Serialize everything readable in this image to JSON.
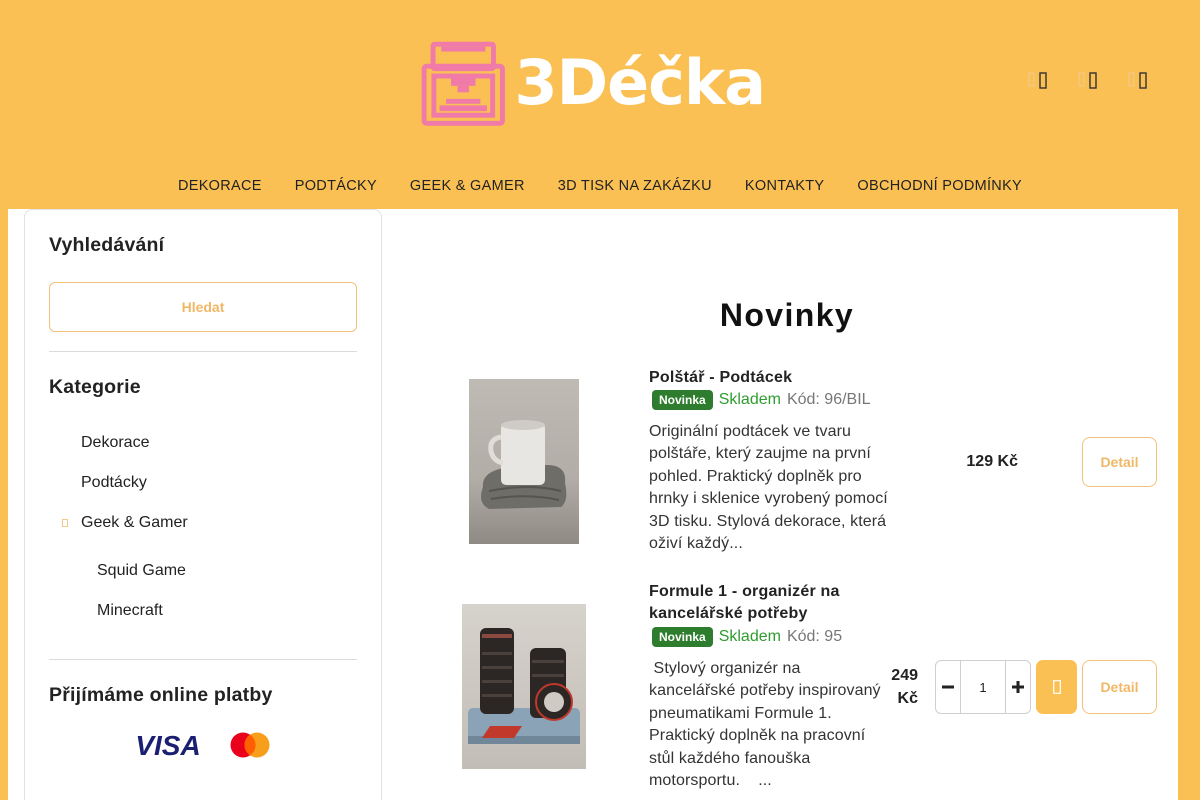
{
  "header": {
    "brand": "3Déčka",
    "icons": [
      "search-icon",
      "user-icon",
      "cart-icon"
    ]
  },
  "nav": {
    "items": [
      "DEKORACE",
      "PODTÁCKY",
      "GEEK & GAMER",
      "3D TISK NA ZAKÁZKU",
      "KONTAKTY",
      "OBCHODNÍ PODMÍNKY"
    ]
  },
  "sidebar": {
    "search_title": "Vyhledávání",
    "search_button": "Hledat",
    "categories_title": "Kategorie",
    "categories": [
      "Dekorace",
      "Podtácky",
      "Geek & Gamer"
    ],
    "subcategories": [
      "Squid Game",
      "Minecraft"
    ],
    "payments_title": "Přijímáme online platby",
    "payments": [
      "VISA",
      "Mastercard"
    ]
  },
  "main": {
    "title": "Novinky",
    "products": [
      {
        "name": "Polštář - Podtácek",
        "badge": "Novinka",
        "stock": "Skladem",
        "code": "Kód: 96/BIL",
        "description": "Originální podtácek ve tvaru polštáře, který zaujme na první pohled. Praktický doplněk pro hrnky i sklenice vyrobený pomocí 3D tisku. Stylová dekorace, která oživí každý...",
        "price": "129 Kč",
        "detail": "Detail"
      },
      {
        "name_line1": "Formule 1 - organizér na",
        "name_line2": "kancelářské potřeby",
        "badge": "Novinka",
        "stock": "Skladem",
        "code": "Kód: 95",
        "description": " Stylový organizér na kancelářské potřeby inspirovaný pneumatikami Formule 1. Praktický doplněk na pracovní stůl každého fanouška motorsportu.    ...",
        "price_line1": "249",
        "price_line2": "Kč",
        "quantity": "1",
        "detail": "Detail"
      }
    ]
  },
  "colors": {
    "background": "#fac054",
    "accent_text": "#f0b866",
    "badge": "#2e7d2e",
    "stock": "#2e9c2e"
  }
}
